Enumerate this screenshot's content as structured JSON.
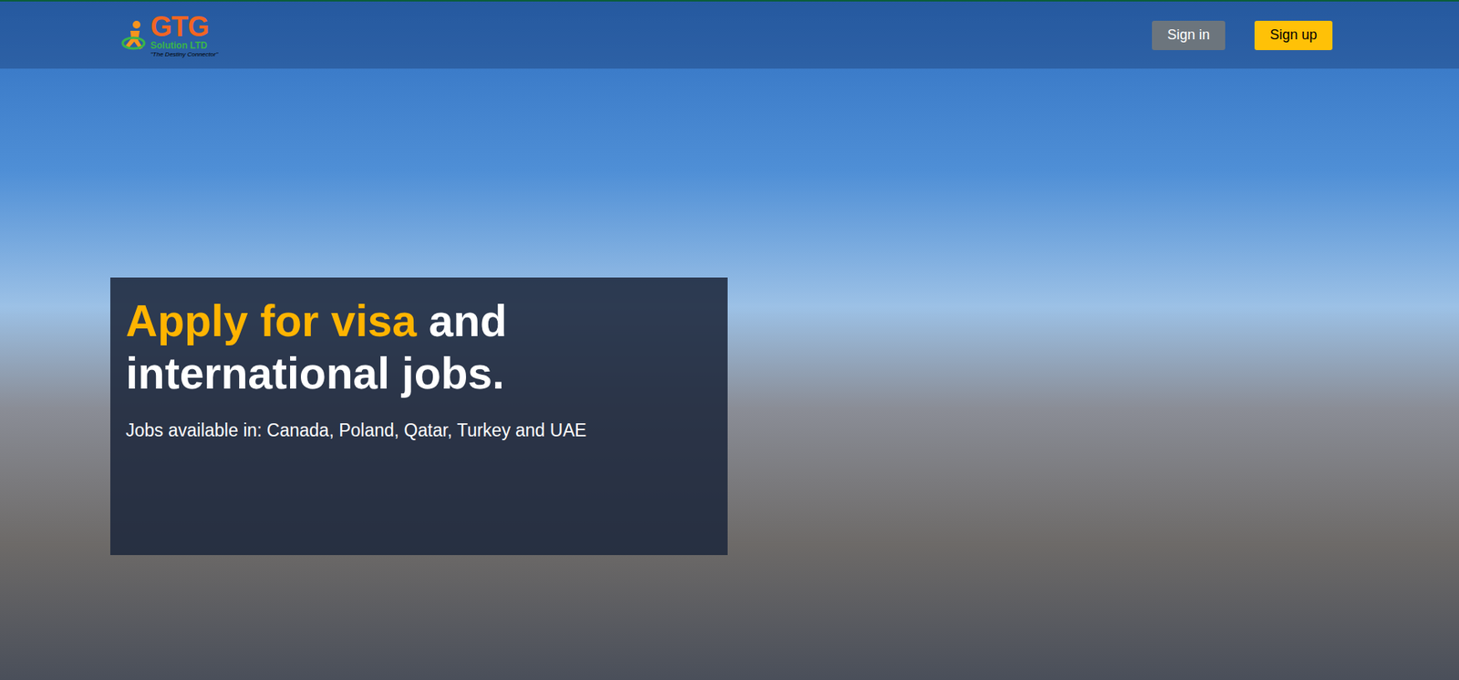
{
  "header": {
    "logo": {
      "name": "GTG",
      "subtitle": "Solution LTD",
      "tagline": "\"The Destiny Connector\""
    },
    "buttons": [
      {
        "label": "Sign in",
        "kind": "secondary"
      },
      {
        "label": "Sign up",
        "kind": "primary"
      }
    ]
  },
  "hero": {
    "heading_highlight": "Apply for visa",
    "heading_rest": "and international jobs.",
    "subtitle": "Jobs available in: Canada, Poland, Qatar, Turkey and UAE"
  }
}
